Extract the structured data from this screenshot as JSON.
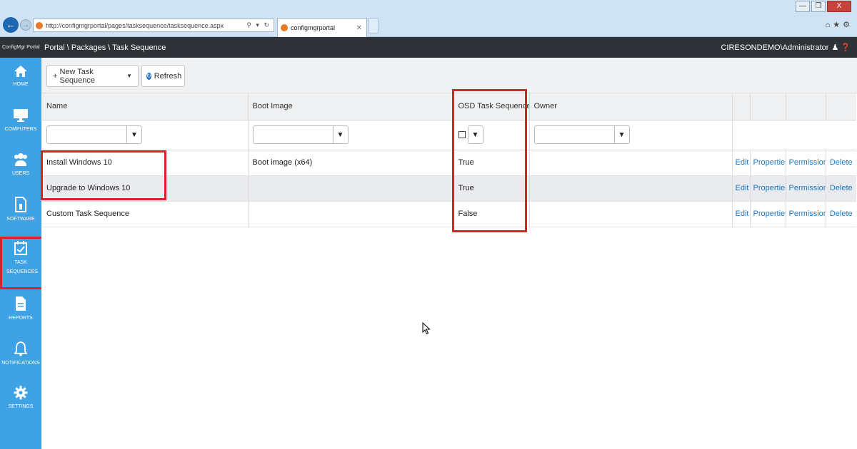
{
  "browser": {
    "address": "http://configmgrportal/pages/tasksequence/tasksequence.aspx",
    "tab_title": "configmgrportal",
    "window_controls": [
      "—",
      "❐",
      "X"
    ]
  },
  "header": {
    "brand": "ConfigMgr Portal",
    "breadcrumb": "Portal \\ Packages \\ Task Sequence",
    "user": "CIRESONDEMO\\Administrator"
  },
  "sidebar": {
    "items": [
      {
        "label": "HOME",
        "icon": "home-icon"
      },
      {
        "label": "COMPUTERS",
        "icon": "monitor-icon"
      },
      {
        "label": "USERS",
        "icon": "users-icon"
      },
      {
        "label": "SOFTWARE",
        "icon": "software-icon"
      },
      {
        "label": "TASK SEQUENCES",
        "icon": "calendar-check-icon",
        "active": true
      },
      {
        "label": "REPORTS",
        "icon": "document-icon"
      },
      {
        "label": "NOTIFICATIONS",
        "icon": "bell-icon"
      },
      {
        "label": "SETTINGS",
        "icon": "gear-icon"
      }
    ]
  },
  "toolbar": {
    "new_label": "New Task Sequence",
    "new_icon": "+",
    "refresh_label": "Refresh"
  },
  "table": {
    "columns": [
      "Name",
      "Boot Image",
      "OSD Task Sequence",
      "Owner"
    ],
    "rows": [
      {
        "name": "Install Windows 10",
        "boot_image": "Boot image (x64)",
        "osd": "True",
        "owner": ""
      },
      {
        "name": "Upgrade to Windows 10",
        "boot_image": "",
        "osd": "True",
        "owner": ""
      },
      {
        "name": "Custom Task Sequence",
        "boot_image": "",
        "osd": "False",
        "owner": ""
      }
    ],
    "actions": [
      "Edit",
      "Properties",
      "Permissions",
      "Delete"
    ]
  },
  "colors": {
    "sidebar": "#3ea2e4",
    "header": "#2f3338",
    "highlight": "#d8232a",
    "link": "#1d78c1"
  }
}
